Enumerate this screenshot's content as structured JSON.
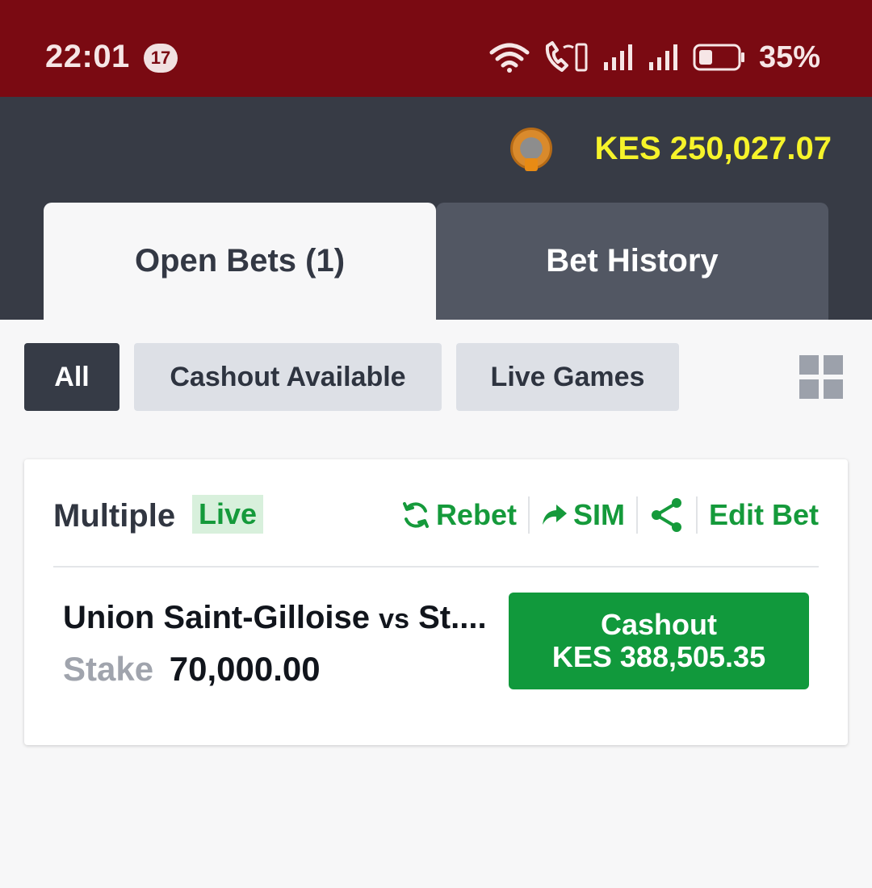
{
  "status_bar": {
    "time": "22:01",
    "notification_count": "17",
    "battery_percent": "35%"
  },
  "header": {
    "balance": "KES 250,027.07"
  },
  "tabs": [
    {
      "label": "Open Bets (1)",
      "active": true
    },
    {
      "label": "Bet History",
      "active": false
    }
  ],
  "filters": [
    {
      "label": "All",
      "active": true
    },
    {
      "label": "Cashout Available",
      "active": false
    },
    {
      "label": "Live Games",
      "active": false
    }
  ],
  "bet": {
    "type": "Multiple",
    "live_label": "Live",
    "actions": {
      "rebet": "Rebet",
      "sim": "SIM",
      "edit": "Edit Bet"
    },
    "match_home": "Union Saint-Gilloise",
    "match_vs": "vs",
    "match_away": "St....",
    "stake_label": "Stake",
    "stake_value": "70,000.00",
    "cashout_label": "Cashout",
    "cashout_amount": "KES 388,505.35"
  },
  "colors": {
    "status_bar": "#7a0a12",
    "header": "#373b45",
    "balance": "#f6f32a",
    "accent_green": "#11993c"
  }
}
